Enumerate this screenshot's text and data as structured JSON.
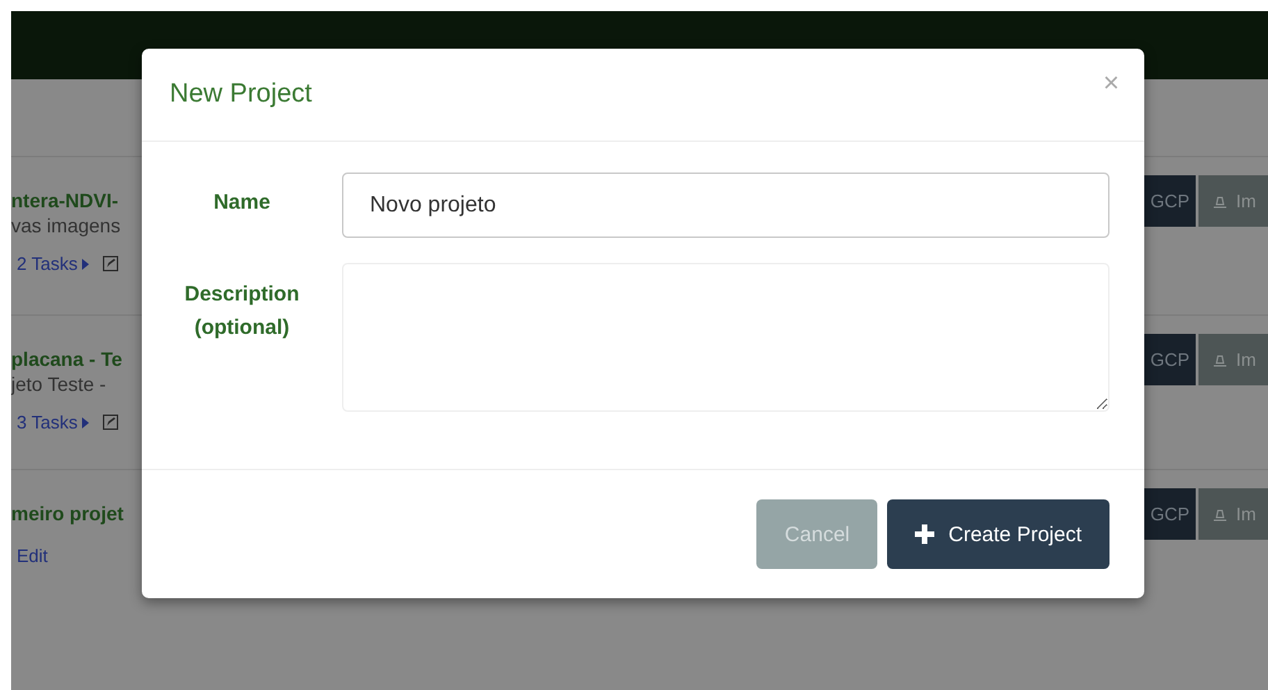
{
  "projects": [
    {
      "kind": "tasks",
      "title": "ntera-NDVI-",
      "description": "vas imagens",
      "tasks": "2 Tasks"
    },
    {
      "kind": "tasks",
      "title": "placana - Te",
      "description": "jeto Teste -",
      "tasks": "3 Tasks"
    },
    {
      "kind": "edit",
      "title": "meiro projet",
      "link": "Edit"
    }
  ],
  "row_actions": [
    {
      "gcp": "GCP",
      "import": "Im"
    },
    {
      "gcp": "GCP",
      "import": "Im"
    },
    {
      "gcp": "GCP",
      "import": "Im"
    }
  ],
  "dialog": {
    "title": "New Project",
    "close": "×",
    "fields": [
      {
        "kind": "input",
        "label": "Name",
        "value": "Novo projeto"
      },
      {
        "kind": "textarea",
        "label": "Description (optional)"
      }
    ],
    "buttons": [
      {
        "kind": "cancel",
        "label": "Cancel"
      },
      {
        "kind": "primary",
        "label": "Create Project"
      }
    ]
  }
}
